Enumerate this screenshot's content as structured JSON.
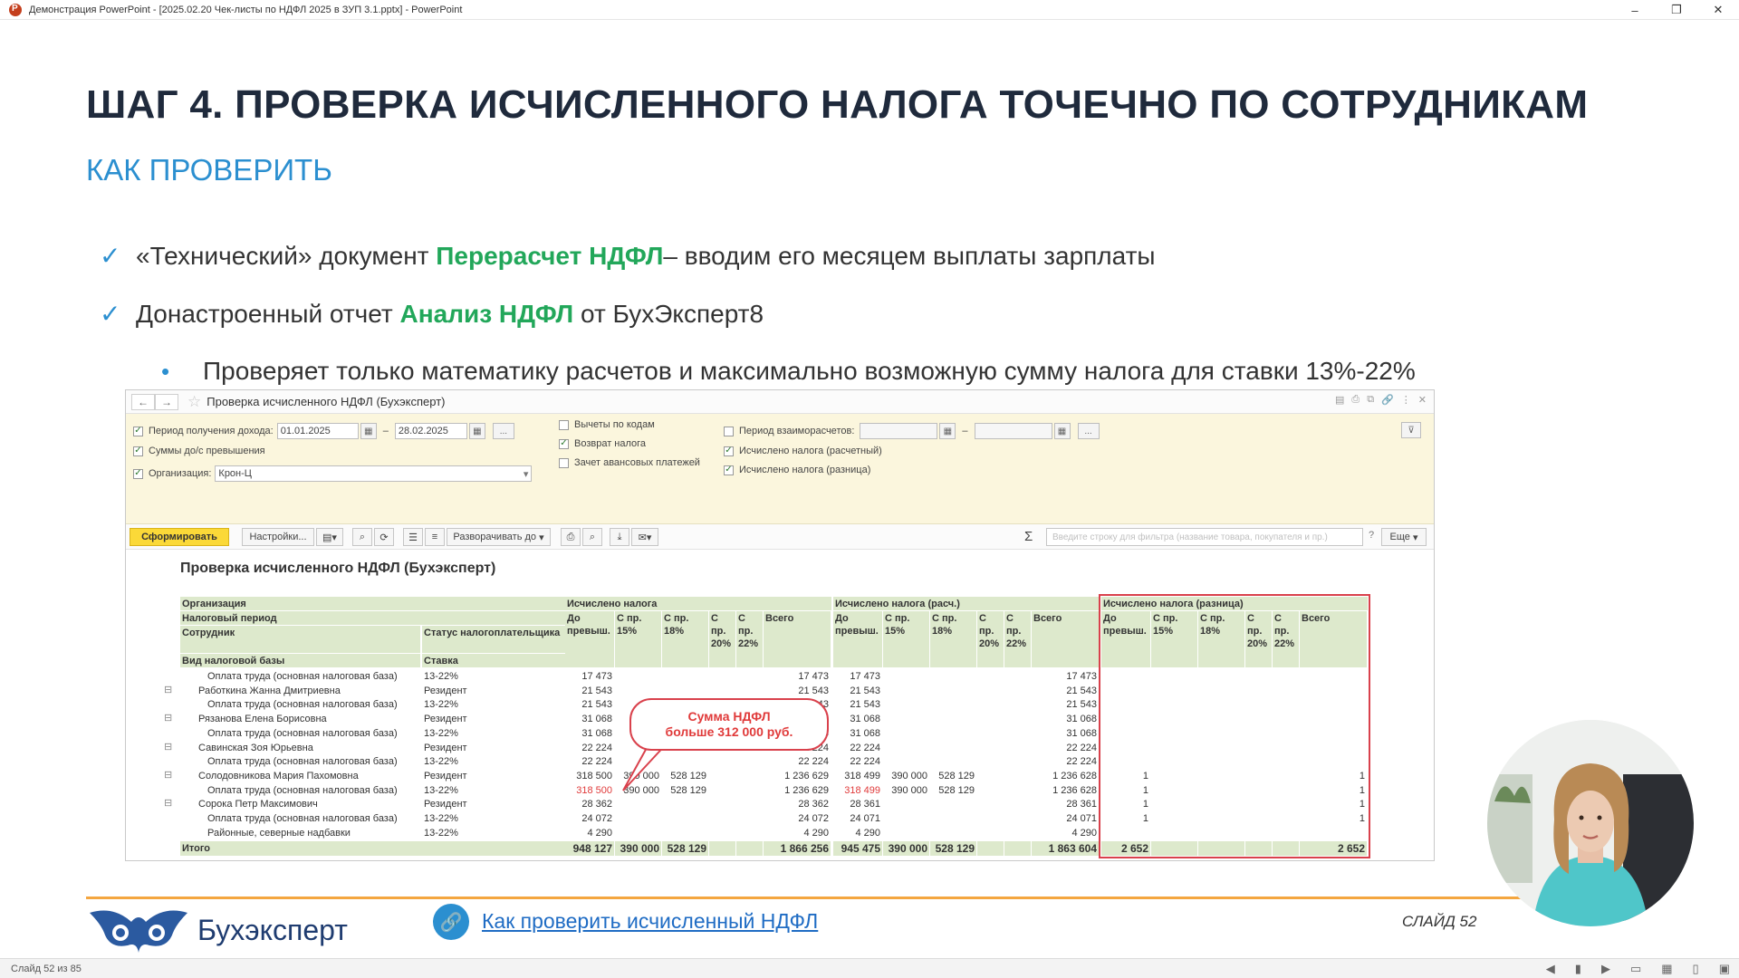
{
  "window": {
    "title": "Демонстрация PowerPoint - [2025.02.20 Чек-листы по НДФЛ 2025 в ЗУП 3.1.pptx] - PowerPoint",
    "minimize": "–",
    "restore": "❐",
    "close": "✕"
  },
  "slide": {
    "title": "ШАГ 4. ПРОВЕРКА ИСЧИСЛЕННОГО НАЛОГА ТОЧЕЧНО ПО СОТРУДНИКАМ",
    "subtitle": "КАК ПРОВЕРИТЬ",
    "bullets": [
      {
        "pre": "«Технический» документ ",
        "highlight": "Перерасчет НДФЛ",
        "post": " – вводим его месяцем выплаты зарплаты"
      },
      {
        "pre": "Донастроенный отчет ",
        "highlight": "Анализ НДФЛ",
        "post": " от БухЭксперт8"
      }
    ],
    "sub_bullet": "Проверяет только математику расчетов и максимально возможную сумму налога для ставки 13%-22%",
    "check_glyph": "✓",
    "dot_glyph": "•",
    "callout_line1": "Сумма НДФЛ",
    "callout_line2": "больше 312 000 руб.",
    "logo_text": "Бухэксперт",
    "link_text": "Как проверить исчисленный НДФЛ",
    "link_icon": "🔗",
    "slide_num": "СЛАЙД 52",
    "accent_color": "#2b8fd0",
    "highlight_color": "#22a75a",
    "footer_line_color": "#f4a640"
  },
  "onec": {
    "back": "←",
    "forward": "→",
    "star": "☆",
    "title": "Проверка исчисленного НДФЛ (Бухэксперт)",
    "head_icons": [
      "▤",
      "⎙",
      "⧉",
      "🔗",
      "⋮",
      "✕"
    ],
    "filters": {
      "period_label": "Период получения дохода:",
      "date_from": "01.01.2025",
      "dash": "–",
      "date_to": "28.02.2025",
      "dots": "...",
      "sum_label": "Суммы до/с превышения",
      "org_label": "Организация:",
      "org_value": "Крон-Ц",
      "deductions": "Вычеты по кодам",
      "tax_return": "Возврат налога",
      "advance_offset": "Зачет авансовых платежей",
      "settlement_period": "Период взаиморасчетов:",
      "calc_tax": "Исчислено налога (расчетный)",
      "diff_tax": "Исчислено налога (разница)"
    },
    "toolbar": {
      "generate": "Сформировать",
      "settings": "Настройки...",
      "expand": "Разворачивать до",
      "sigma": "Σ",
      "search_placeholder": "Введите строку для фильтра (название товара, покупателя и пр.)",
      "question": "?",
      "more": "Еще"
    },
    "report": {
      "title": "Проверка исчисленного НДФЛ (Бухэксперт)",
      "left_headers": {
        "org": "Организация",
        "period": "Налоговый период",
        "employee": "Сотрудник",
        "status": "Статус налогоплательщика",
        "base": "Вид налоговой базы",
        "rate": "Ставка"
      },
      "groups": [
        "Исчислено налога",
        "Исчислено налога (расч.)",
        "Исчислено налога (разница)"
      ],
      "sub_headers": [
        "До превыш.",
        "С пр. 15%",
        "С пр. 18%",
        "С пр. 20%",
        "С пр. 22%",
        "Всего"
      ],
      "rows": [
        {
          "name": "Оплата труда (основная налоговая база)",
          "status": "13-22%",
          "level": 2,
          "vals": [
            "17 473",
            "",
            "",
            "",
            "",
            "17 473",
            "17 473",
            "",
            "",
            "",
            "",
            "17 473",
            "",
            "",
            "",
            "",
            "",
            ""
          ]
        },
        {
          "name": "Работкина Жанна Дмитриевна",
          "status": "Резидент",
          "level": 1,
          "vals": [
            "21 543",
            "",
            "",
            "",
            "",
            "21 543",
            "21 543",
            "",
            "",
            "",
            "",
            "21 543",
            "",
            "",
            "",
            "",
            "",
            ""
          ]
        },
        {
          "name": "Оплата труда (основная налоговая база)",
          "status": "13-22%",
          "level": 2,
          "vals": [
            "21 543",
            "",
            "",
            "",
            "",
            "21 543",
            "21 543",
            "",
            "",
            "",
            "",
            "21 543",
            "",
            "",
            "",
            "",
            "",
            ""
          ]
        },
        {
          "name": "Рязанова Елена Борисовна",
          "status": "Резидент",
          "level": 1,
          "vals": [
            "31 068",
            "",
            "",
            "",
            "",
            "31 068",
            "31 068",
            "",
            "",
            "",
            "",
            "31 068",
            "",
            "",
            "",
            "",
            "",
            ""
          ]
        },
        {
          "name": "Оплата труда (основная налоговая база)",
          "status": "13-22%",
          "level": 2,
          "vals": [
            "31 068",
            "",
            "",
            "",
            "",
            "31 068",
            "31 068",
            "",
            "",
            "",
            "",
            "31 068",
            "",
            "",
            "",
            "",
            "",
            ""
          ]
        },
        {
          "name": "Савинская Зоя Юрьевна",
          "status": "Резидент",
          "level": 1,
          "vals": [
            "22 224",
            "",
            "",
            "",
            "",
            "22 224",
            "22 224",
            "",
            "",
            "",
            "",
            "22 224",
            "",
            "",
            "",
            "",
            "",
            ""
          ]
        },
        {
          "name": "Оплата труда (основная налоговая база)",
          "status": "13-22%",
          "level": 2,
          "vals": [
            "22 224",
            "",
            "",
            "",
            "",
            "22 224",
            "22 224",
            "",
            "",
            "",
            "",
            "22 224",
            "",
            "",
            "",
            "",
            "",
            ""
          ]
        },
        {
          "name": "Солодовникова Мария Пахомовна",
          "status": "Резидент",
          "level": 1,
          "vals": [
            "318 500",
            "390 000",
            "528 129",
            "",
            "",
            "1 236 629",
            "318 499",
            "390 000",
            "528 129",
            "",
            "",
            "1 236 628",
            "1",
            "",
            "",
            "",
            "",
            "1"
          ]
        },
        {
          "name": "Оплата труда (основная налоговая база)",
          "status": "13-22%",
          "level": 2,
          "red": [
            0,
            6
          ],
          "vals": [
            "318 500",
            "390 000",
            "528 129",
            "",
            "",
            "1 236 629",
            "318 499",
            "390 000",
            "528 129",
            "",
            "",
            "1 236 628",
            "1",
            "",
            "",
            "",
            "",
            "1"
          ]
        },
        {
          "name": "Сорока Петр Максимович",
          "status": "Резидент",
          "level": 1,
          "vals": [
            "28 362",
            "",
            "",
            "",
            "",
            "28 362",
            "28 361",
            "",
            "",
            "",
            "",
            "28 361",
            "1",
            "",
            "",
            "",
            "",
            "1"
          ]
        },
        {
          "name": "Оплата труда (основная налоговая база)",
          "status": "13-22%",
          "level": 2,
          "vals": [
            "24 072",
            "",
            "",
            "",
            "",
            "24 072",
            "24 071",
            "",
            "",
            "",
            "",
            "24 071",
            "1",
            "",
            "",
            "",
            "",
            "1"
          ]
        },
        {
          "name": "Районные, северные надбавки",
          "status": "13-22%",
          "level": 2,
          "vals": [
            "4 290",
            "",
            "",
            "",
            "",
            "4 290",
            "4 290",
            "",
            "",
            "",
            "",
            "4 290",
            "",
            "",
            "",
            "",
            "",
            ""
          ]
        }
      ],
      "total": {
        "label": "Итого",
        "vals": [
          "948 127",
          "390 000",
          "528 129",
          "",
          "",
          "1 866 256",
          "945 475",
          "390 000",
          "528 129",
          "",
          "",
          "1 863 604",
          "2 652",
          "",
          "",
          "",
          "",
          "2 652"
        ]
      },
      "header_color": "#dde9cc",
      "frame_color": "#d9414c"
    }
  },
  "statusbar": {
    "slide_info": "Слайд 52 из 85",
    "icons": [
      "◀",
      "▮",
      "▶",
      "▭",
      "▦",
      "▯",
      "▣"
    ]
  }
}
